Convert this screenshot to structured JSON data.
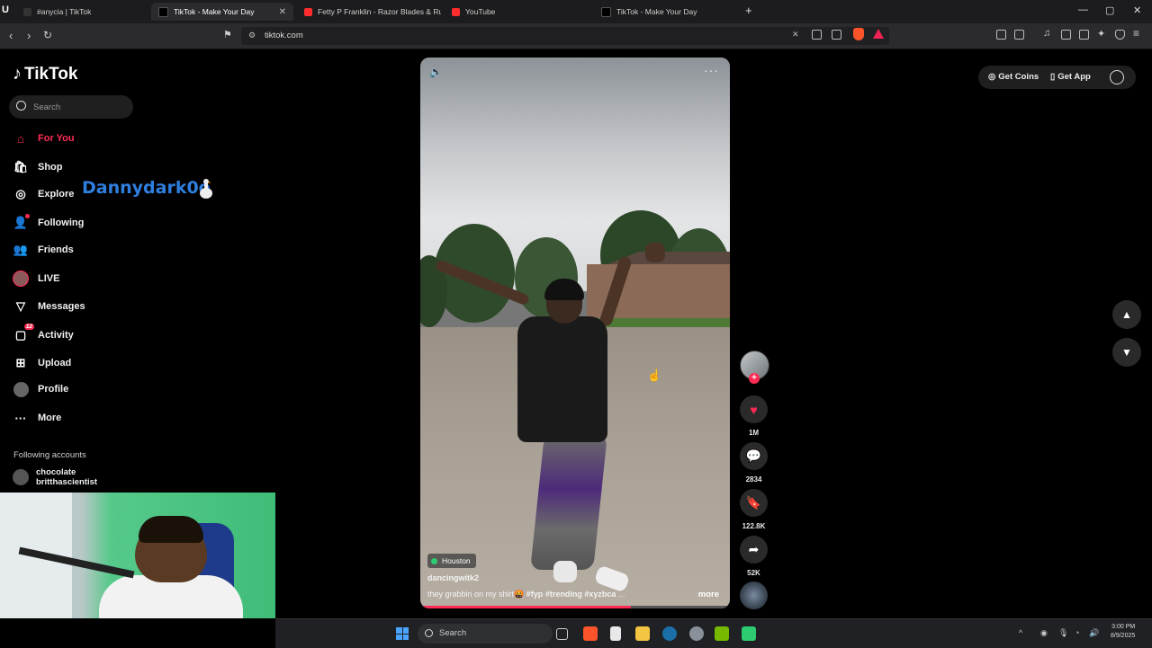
{
  "browser": {
    "tabs": [
      {
        "title": "#anycia | TikTok",
        "active": false
      },
      {
        "title": "TikTok - Make Your Day",
        "active": true
      },
      {
        "title": "Fetty P Franklin - Razor Blades & Ru",
        "active": false
      },
      {
        "title": "YouTube",
        "active": false
      },
      {
        "title": "TikTok - Make Your Day",
        "active": false
      }
    ],
    "new_tab": "+",
    "url": "tiktok.com",
    "controls": {
      "minimize": "—",
      "maximize": "▢",
      "close": "✕"
    }
  },
  "sidebar": {
    "logo": "TikTok",
    "search_placeholder": "Search",
    "items": [
      {
        "label": "For You",
        "icon": "home-icon"
      },
      {
        "label": "Shop",
        "icon": "shop-icon"
      },
      {
        "label": "Explore",
        "icon": "compass-icon"
      },
      {
        "label": "Following",
        "icon": "following-icon"
      },
      {
        "label": "Friends",
        "icon": "friends-icon"
      },
      {
        "label": "LIVE",
        "icon": "live-icon"
      },
      {
        "label": "Messages",
        "icon": "messages-icon"
      },
      {
        "label": "Activity",
        "icon": "activity-icon",
        "badge": "12"
      },
      {
        "label": "Upload",
        "icon": "upload-icon"
      },
      {
        "label": "Profile",
        "icon": "profile-icon"
      },
      {
        "label": "More",
        "icon": "more-icon"
      }
    ],
    "following_title": "Following accounts",
    "following_accounts": [
      "chocolate",
      "britthascientist"
    ]
  },
  "overlay_name": "Dannydark0o",
  "video": {
    "location": "Houston",
    "author": "dancingwitk2",
    "caption": "they grabbin on my shirt🤬",
    "hashtags": [
      "#fyp",
      "#trending",
      "#xyzbca"
    ],
    "ellipsis": "...",
    "more_label": "more",
    "progress_fraction": 0.68
  },
  "actions": {
    "likes": "1M",
    "comments": "2834",
    "saves": "122.8K",
    "shares": "52K",
    "follow_plus": "+"
  },
  "header": {
    "get_coins": "Get Coins",
    "get_app": "Get App"
  },
  "taskbar": {
    "search_placeholder": "Search",
    "time": "3:00 PM",
    "date": "8/9/2025"
  },
  "colors": {
    "accent": "#fe2c55",
    "overlay_name": "#2f7fe0"
  }
}
